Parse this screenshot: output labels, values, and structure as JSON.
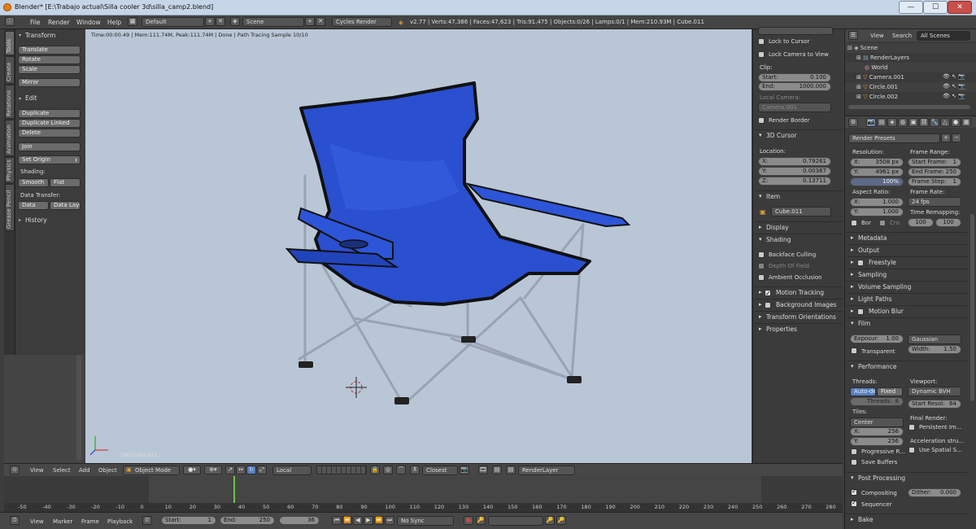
{
  "window": {
    "title": "Blender* [E:\\Trabajo actual\\Silla cooler 3d\\silla_camp2.blend]",
    "min": "—",
    "max": "☐",
    "close": "✕"
  },
  "menubar": {
    "file": "File",
    "render": "Render",
    "window": "Window",
    "help": "Help",
    "layout": "Default",
    "scene": "Scene",
    "engine": "Cycles Render",
    "stats": "v2.77 | Verts:47,386 | Faces:47,623 | Tris:91,475 | Objects:0/26 | Lamps:0/1 | Mem:210.93M | Cube.011"
  },
  "lefttabs": [
    "Tools",
    "Create",
    "Relations",
    "Animation",
    "Physics",
    "Grease Pencil"
  ],
  "toolshelf": {
    "transform": "Transform",
    "translate": "Translate",
    "rotate": "Rotate",
    "scale": "Scale",
    "mirror": "Mirror",
    "edit": "Edit",
    "duplicate": "Duplicate",
    "duplicate_linked": "Duplicate Linked",
    "delete": "Delete",
    "join": "Join",
    "set_origin": "Set Origin",
    "shading": "Shading:",
    "smooth": "Smooth",
    "flat": "Flat",
    "data_transfer": "Data Transfer:",
    "data": "Data",
    "data_layo": "Data Layo",
    "history": "History"
  },
  "viewport": {
    "info": "Time:00:00.49 | Mem:111.74M, Peak:111.74M | Done | Path Tracing Sample 10/10",
    "object": "(36) Cube.011"
  },
  "npanel": {
    "lock_cursor": "Lock to Cursor",
    "lock_camera": "Lock Camera to View",
    "clip": "Clip:",
    "start_lbl": "Start:",
    "start_val": "0.100",
    "end_lbl": "End:",
    "end_val": "1000.000",
    "local_camera": "Local Camera:",
    "camera": "Camera.001",
    "render_border": "Render Border",
    "cursor3d": "3D Cursor",
    "location": "Location:",
    "x_lbl": "X:",
    "x_val": "0.79261",
    "y_lbl": "Y:",
    "y_val": "0.00367",
    "z_lbl": "Z:",
    "z_val": "0.13711",
    "item": "Item",
    "item_name": "Cube.011",
    "display": "Display",
    "shading": "Shading",
    "backface": "Backface Culling",
    "depth_of_field": "Depth Of Field",
    "ambient_occlusion": "Ambient Occlusion",
    "motion_tracking": "Motion Tracking",
    "background_images": "Background Images",
    "transform_orientations": "Transform Orientations",
    "properties": "Properties"
  },
  "outliner": {
    "view": "View",
    "search": "Search",
    "all_scenes": "All Scenes",
    "items": [
      "Scene",
      "RenderLayers",
      "World",
      "Camera.001",
      "Circle.001",
      "Circle.002"
    ]
  },
  "props": {
    "render_presets": "Render Presets",
    "resolution": "Resolution:",
    "res_x_lbl": "X:",
    "res_x": "3508 px",
    "res_y_lbl": "Y:",
    "res_y": "4961 px",
    "res_pct": "100%",
    "frame_range": "Frame Range:",
    "start_frame_lbl": "Start Frame:",
    "start_frame": "1",
    "end_frame_lbl": "End Frame:",
    "end_frame": "250",
    "frame_step_lbl": "Frame Step:",
    "frame_step": "1",
    "aspect_ratio": "Aspect Ratio:",
    "asp_x_lbl": "X:",
    "asp_x": "1.000",
    "asp_y_lbl": "Y:",
    "asp_y": "1.000",
    "frame_rate": "Frame Rate:",
    "fps": "24 fps",
    "time_remapping": "Time Remapping:",
    "remap_old": "100",
    "remap_new": "100",
    "bor": "Bor",
    "cro": "Cro",
    "metadata": "Metadata",
    "output": "Output",
    "freestyle": "Freestyle",
    "sampling": "Sampling",
    "volume_sampling": "Volume Sampling",
    "light_paths": "Light Paths",
    "motion_blur": "Motion Blur",
    "film": "Film",
    "exposure_lbl": "Exposur:",
    "exposure": "1.00",
    "filter": "Gaussian",
    "width_lbl": "Width:",
    "width": "1.50",
    "transparent": "Transparent",
    "performance": "Performance",
    "threads": "Threads:",
    "auto_detect": "Auto-dete",
    "fixed": "Fixed",
    "threads_lbl": "Threads:",
    "threads_val": "8",
    "viewport": "Viewport:",
    "dynamic_bvh": "Dynamic BVH",
    "start_resol_lbl": "Start Resol:",
    "start_resol": "64",
    "tiles": "Tiles:",
    "center": "Center",
    "tile_x_lbl": "X:",
    "tile_x": "256",
    "tile_y_lbl": "Y:",
    "tile_y": "256",
    "final_render": "Final Render:",
    "persistent": "Persistent Im...",
    "accel": "Acceleration stru...",
    "spatial": "Use Spatial S...",
    "progressive": "Progressive R...",
    "save_buffers": "Save Buffers",
    "post_processing": "Post Processing",
    "compositing": "Compositing",
    "dither_lbl": "Dither:",
    "dither": "0.000",
    "sequencer": "Sequencer",
    "bake": "Bake"
  },
  "vheader": {
    "view": "View",
    "select": "Select",
    "add": "Add",
    "object": "Object",
    "mode": "Object Mode",
    "pivot": "Local",
    "snap": "Closest",
    "render_layer": "RenderLayer"
  },
  "timeline": {
    "ticks": [
      "-50",
      "-40",
      "-30",
      "-20",
      "-10",
      "0",
      "10",
      "20",
      "30",
      "40",
      "50",
      "60",
      "70",
      "80",
      "90",
      "100",
      "110",
      "120",
      "130",
      "140",
      "150",
      "160",
      "170",
      "180",
      "190",
      "200",
      "210",
      "220",
      "230",
      "240",
      "250",
      "260",
      "270",
      "280"
    ],
    "current": 36
  },
  "tlheader": {
    "view": "View",
    "marker": "Marker",
    "frame": "Frame",
    "playback": "Playback",
    "start_lbl": "Start:",
    "start": "1",
    "end_lbl": "End:",
    "end": "250",
    "current": "36",
    "sync": "No Sync"
  }
}
